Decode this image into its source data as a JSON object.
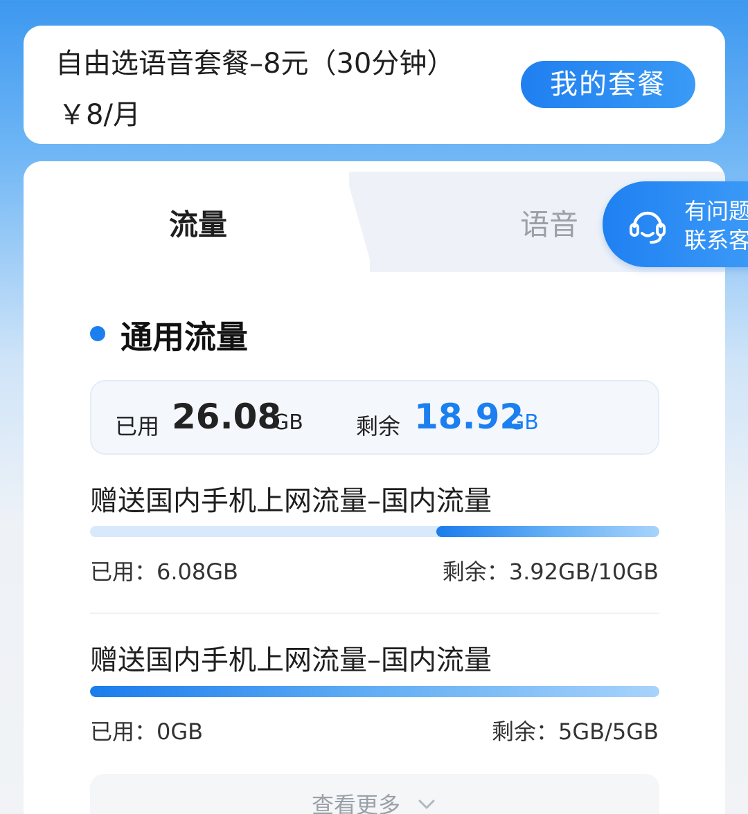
{
  "plan": {
    "name": "自由选语音套餐–8元（30分钟）",
    "price": "￥8/月",
    "my_plan_button": "我的套餐"
  },
  "tabs": [
    {
      "label": "流量",
      "active": true
    },
    {
      "label": "语音",
      "active": false
    }
  ],
  "service": {
    "line1": "有问题",
    "line2": "联系客",
    "icon": "headset-icon"
  },
  "section": {
    "title": "通用流量",
    "summary": {
      "used_label": "已用",
      "used_value": "26.08",
      "used_unit": "GB",
      "remaining_label": "剩余",
      "remaining_value": "18.92",
      "remaining_unit": "GB"
    },
    "items": [
      {
        "title": "赠送国内手机上网流量–国内流量",
        "used": "已用：6.08GB",
        "remaining": "剩余：3.92GB/10GB",
        "remaining_fraction": 0.392
      },
      {
        "title": "赠送国内手机上网流量–国内流量",
        "used": "已用：0GB",
        "remaining": "剩余：5GB/5GB",
        "remaining_fraction": 1.0
      }
    ],
    "more_label": "查看更多"
  },
  "colors": {
    "accent": "#1c7ff0",
    "bar_track": "#d8e9fb"
  }
}
